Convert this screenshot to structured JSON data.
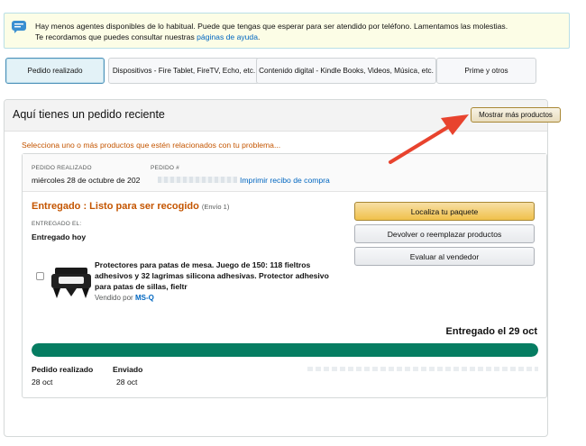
{
  "notice": {
    "line1": "Hay menos agentes disponibles de lo habitual. Puede que tengas que esperar para ser atendido por teléfono. Lamentamos las molestias.",
    "line2_prefix": "Te recordamos que puedes consultar nuestras ",
    "line2_link": "páginas de ayuda",
    "line2_suffix": "."
  },
  "tabs": [
    {
      "label": "Pedido realizado",
      "active": true
    },
    {
      "label": "Dispositivos - Fire Tablet, FireTV, Echo, etc.",
      "active": false
    },
    {
      "label": "Contenido digital - Kindle Books, Videos, Música, etc.",
      "active": false
    },
    {
      "label": "Prime y otros",
      "active": false
    }
  ],
  "panel": {
    "title": "Aquí tienes un pedido reciente",
    "more_button": "Mostrar más productos",
    "select_message": "Selecciona uno o más productos que estén relacionados con tu problema..."
  },
  "order": {
    "date_label": "PEDIDO REALIZADO",
    "date_value": "miércoles 28 de octubre de 202",
    "number_label": "PEDIDO #",
    "print_link": "Imprimir recibo de compra",
    "status": "Entregado : Listo para ser recogido",
    "shipment": "(Envío 1)",
    "delivered_label": "ENTREGADO EL:",
    "delivered_value": "Entregado hoy",
    "product": {
      "title": "Protectores para patas de mesa. Juego de 150: 118 fieltros adhesivos y 32 lagrimas silicona adhesivas. Protector adhesivo para patas de sillas, fieltr",
      "sold_by_label": "Vendido por ",
      "seller": "MS-Q"
    },
    "actions": {
      "track": "Localiza tu paquete",
      "return": "Devolver o reemplazar productos",
      "rate": "Evaluar al vendedor"
    },
    "delivered_date_heading": "Entregado el 29 oct",
    "progress_fraction": 1.0,
    "steps": [
      {
        "label": "Pedido realizado",
        "date": "28 oct"
      },
      {
        "label": "Enviado",
        "date": "28 oct"
      }
    ]
  },
  "colors": {
    "accent_orange": "#c45500",
    "link_blue": "#0066c0",
    "progress_green": "#067d62",
    "arrow_red": "#e8432e"
  }
}
